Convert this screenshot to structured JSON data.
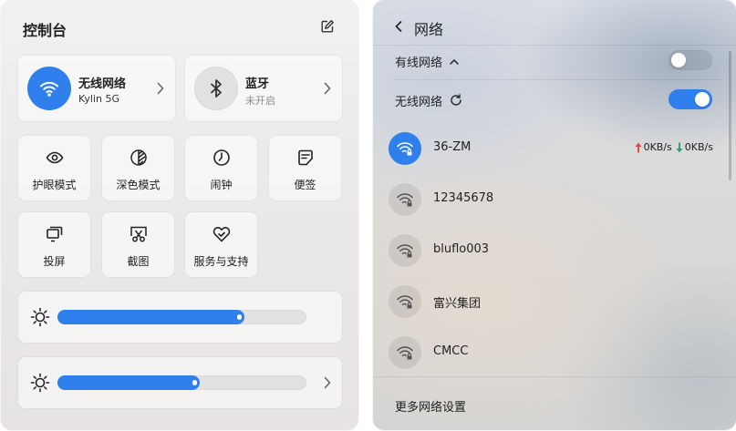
{
  "control_center": {
    "title": "控制台",
    "edit_icon": "edit-icon",
    "wifi_card": {
      "name": "无线网络",
      "status": "Kylin 5G",
      "icon": "wifi-icon"
    },
    "bluetooth_card": {
      "name": "蓝牙",
      "status": "未开启",
      "icon": "bluetooth-icon"
    },
    "tiles": [
      {
        "label": "护眼模式",
        "icon": "eye-icon"
      },
      {
        "label": "深色模式",
        "icon": "dark-mode-icon"
      },
      {
        "label": "闹钟",
        "icon": "clock-icon"
      },
      {
        "label": "便签",
        "icon": "notes-icon"
      },
      {
        "label": "投屏",
        "icon": "screen-cast-icon"
      },
      {
        "label": "截图",
        "icon": "screenshot-icon"
      },
      {
        "label": "服务与支持",
        "icon": "support-icon"
      }
    ],
    "brightness_level": 0.75,
    "volume_level": 0.57
  },
  "network_panel": {
    "title": "网络",
    "wired": {
      "label": "有线网络",
      "enabled": false
    },
    "wireless": {
      "label": "无线网络",
      "enabled": true
    },
    "networks": [
      {
        "ssid": "36-ZM",
        "connected": true,
        "upload": "0KB/s",
        "download": "0KB/s"
      },
      {
        "ssid": "12345678",
        "connected": false
      },
      {
        "ssid": "bluflo003",
        "connected": false
      },
      {
        "ssid": "富兴集团",
        "connected": false
      },
      {
        "ssid": "CMCC",
        "connected": false
      }
    ],
    "more_settings": "更多网络设置"
  },
  "colors": {
    "accent": "#2f80ed",
    "upload": "#e5484d",
    "download": "#30a46c"
  }
}
